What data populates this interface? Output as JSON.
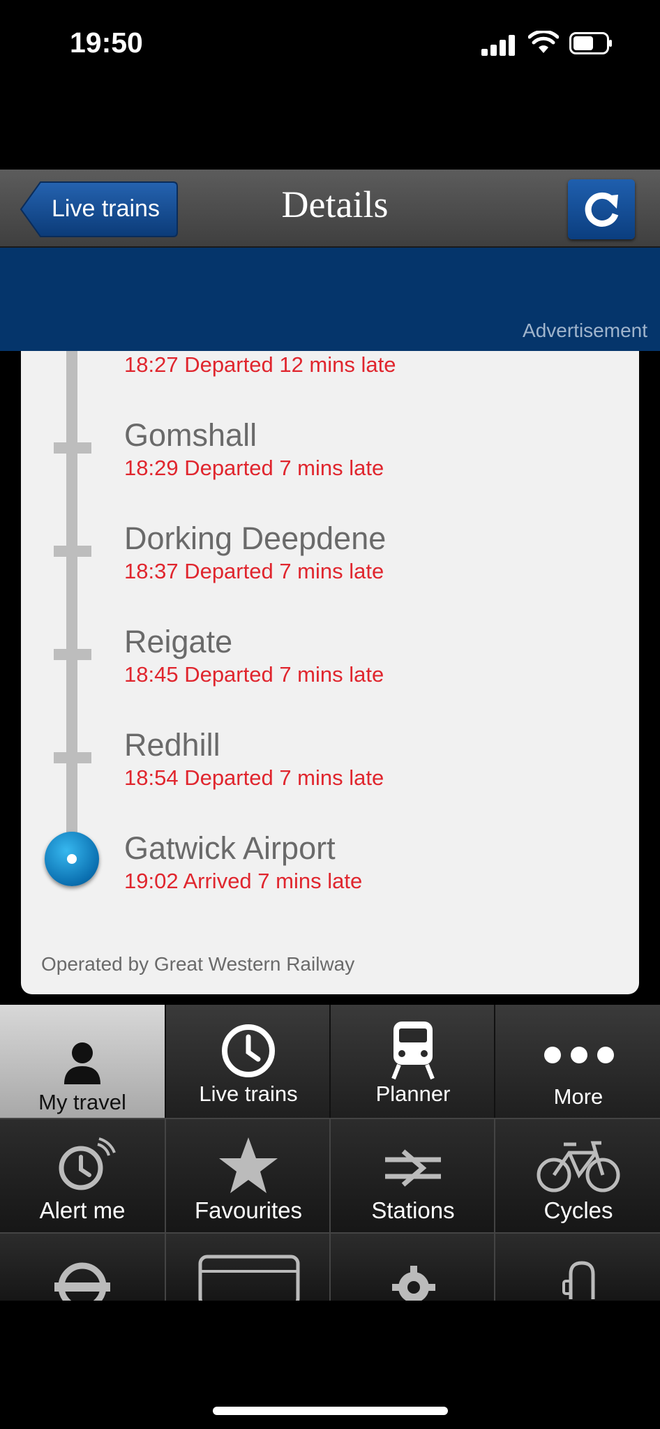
{
  "status_bar": {
    "time": "19:50"
  },
  "nav": {
    "back_label": "Live trains",
    "title": "Details"
  },
  "ad": {
    "label": "Advertisement"
  },
  "stops": [
    {
      "name": "",
      "status": "18:27 Departed 12 mins late"
    },
    {
      "name": "Gomshall",
      "status": "18:29 Departed 7 mins late"
    },
    {
      "name": "Dorking Deepdene",
      "status": "18:37 Departed 7 mins late"
    },
    {
      "name": "Reigate",
      "status": "18:45 Departed 7 mins late"
    },
    {
      "name": "Redhill",
      "status": "18:54 Departed 7 mins late"
    },
    {
      "name": "Gatwick Airport",
      "status": "19:02 Arrived 7 mins late"
    }
  ],
  "operator": "Operated by Great Western Railway",
  "tabs": [
    {
      "label": "My travel",
      "icon": "person-icon"
    },
    {
      "label": "Live trains",
      "icon": "clock-icon"
    },
    {
      "label": "Planner",
      "icon": "train-icon"
    },
    {
      "label": "More",
      "icon": "more-icon"
    }
  ],
  "more_menu": [
    {
      "label": "Alert me",
      "icon": "alert-clock-icon"
    },
    {
      "label": "Favourites",
      "icon": "star-icon"
    },
    {
      "label": "Stations",
      "icon": "national-rail-icon"
    },
    {
      "label": "Cycles",
      "icon": "bicycle-icon"
    }
  ],
  "colors": {
    "accent_blue": "#05356b",
    "late_red": "#e0262e"
  }
}
